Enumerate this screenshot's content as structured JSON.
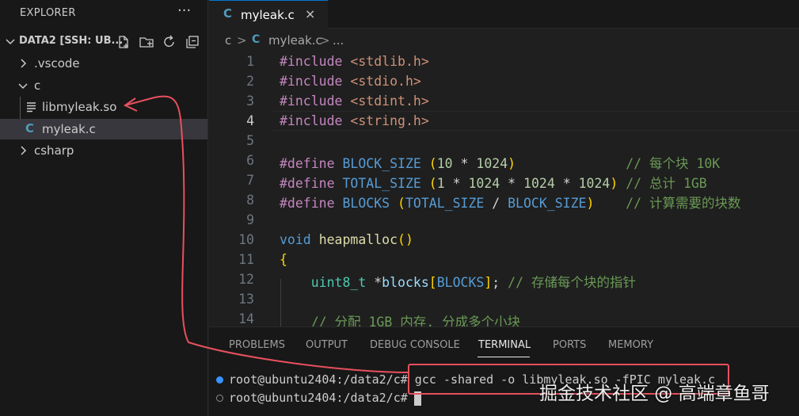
{
  "sidebar": {
    "header": "EXPLORER",
    "more_icon": "ellipsis-icon",
    "workspace": {
      "label": "DATA2 [SSH: UB...",
      "actions": [
        "new-file-icon",
        "new-folder-icon",
        "refresh-icon",
        "collapse-all-icon"
      ]
    },
    "tree": [
      {
        "label": ".vscode",
        "type": "folder",
        "expanded": false
      },
      {
        "label": "c",
        "type": "folder",
        "expanded": true
      },
      {
        "label": "libmyleak.so",
        "type": "file",
        "icon": "lines-file-icon"
      },
      {
        "label": "myleak.c",
        "type": "file",
        "icon": "c-file-icon",
        "icon_text": "C",
        "selected": true
      },
      {
        "label": "csharp",
        "type": "folder",
        "expanded": false
      }
    ]
  },
  "editor": {
    "tab": {
      "icon_text": "C",
      "label": "myleak.c",
      "close": "×"
    },
    "breadcrumb": {
      "folder": "c",
      "sep1": ">",
      "icon_text": "C",
      "file": "myleak.c",
      "sep2": ">",
      "more": "..."
    },
    "active_line": 4,
    "lines": [
      {
        "n": "1",
        "text": "#include <stdlib.h>"
      },
      {
        "n": "2",
        "text": "#include <stdio.h>"
      },
      {
        "n": "3",
        "text": "#include <stdint.h>"
      },
      {
        "n": "4",
        "text": "#include <string.h>"
      },
      {
        "n": "5",
        "text": ""
      },
      {
        "n": "6",
        "text": "#define BLOCK_SIZE (10 * 1024)              // 每个块 10K"
      },
      {
        "n": "7",
        "text": "#define TOTAL_SIZE (1 * 1024 * 1024 * 1024) // 总计 1GB"
      },
      {
        "n": "8",
        "text": "#define BLOCKS (TOTAL_SIZE / BLOCK_SIZE)    // 计算需要的块数"
      },
      {
        "n": "9",
        "text": ""
      },
      {
        "n": "10",
        "text": "void heapmalloc()"
      },
      {
        "n": "11",
        "text": "{"
      },
      {
        "n": "12",
        "text": "    uint8_t *blocks[BLOCKS]; // 存储每个块的指针"
      },
      {
        "n": "13",
        "text": ""
      },
      {
        "n": "14",
        "text": "    // 分配 1GB 内存, 分成多个小块"
      }
    ]
  },
  "panel": {
    "tabs": [
      "PROBLEMS",
      "OUTPUT",
      "DEBUG CONSOLE",
      "TERMINAL",
      "PORTS",
      "MEMORY"
    ],
    "active_tab": "TERMINAL",
    "terminal": [
      {
        "prompt": "root@ubuntu2404:/data2/c#",
        "command": " gcc -shared -o libmyleak.so -fPIC myleak.c",
        "status": "success"
      },
      {
        "prompt": "root@ubuntu2404:/data2/c#",
        "command": " ",
        "status": "idle"
      }
    ]
  },
  "colors": {
    "accent": "#0078d4",
    "annotation": "#e8505e",
    "c_icon": "#519aba",
    "success_dot": "#3794ff"
  },
  "watermark": "掘金技术社区 @ 高端章鱼哥"
}
